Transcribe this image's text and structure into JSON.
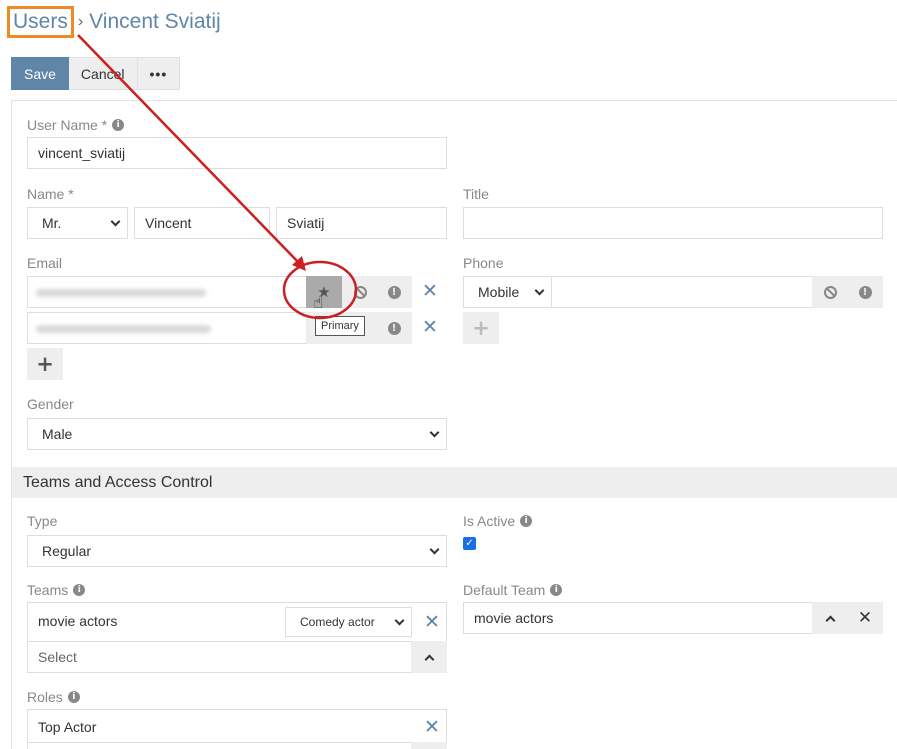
{
  "breadcrumb": {
    "root": "Users",
    "separator": "›",
    "current": "Vincent Sviatij"
  },
  "toolbar": {
    "save": "Save",
    "cancel": "Cancel",
    "more": "•••"
  },
  "fields": {
    "user_name": {
      "label": "User Name *",
      "value": "vincent_sviatij"
    },
    "name": {
      "label": "Name *",
      "salutation": "Mr.",
      "first": "Vincent",
      "last": "Sviatij"
    },
    "title": {
      "label": "Title",
      "value": ""
    },
    "email": {
      "label": "Email",
      "tooltip": "Primary"
    },
    "phone": {
      "label": "Phone",
      "type": "Mobile",
      "value": ""
    },
    "gender": {
      "label": "Gender",
      "value": "Male"
    }
  },
  "section_teams": {
    "title": "Teams and Access Control"
  },
  "access": {
    "type": {
      "label": "Type",
      "value": "Regular"
    },
    "is_active": {
      "label": "Is Active",
      "checked": true
    },
    "teams": {
      "label": "Teams",
      "team": "movie actors",
      "role": "Comedy actor",
      "select_placeholder": "Select"
    },
    "default_team": {
      "label": "Default Team",
      "value": "movie actors"
    },
    "roles": {
      "label": "Roles",
      "value": "Top Actor"
    }
  },
  "colors": {
    "accent": "#5f86a8",
    "highlight_box": "#f08a24",
    "annotation": "#cc1f1f"
  }
}
